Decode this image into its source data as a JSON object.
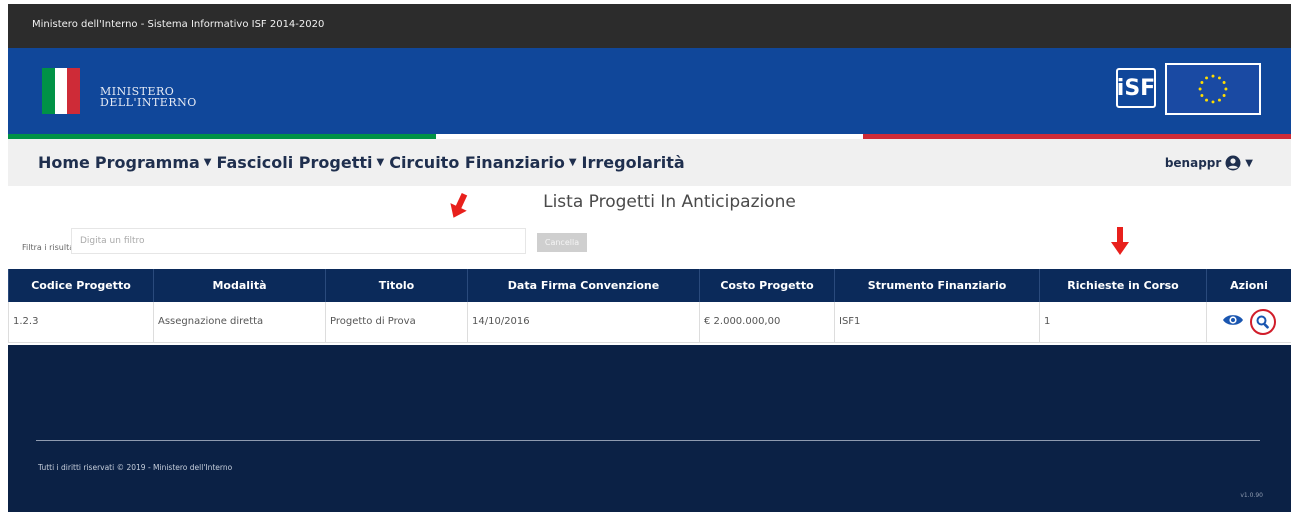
{
  "topbar": {
    "title": "Ministero dell'Interno - Sistema Informativo ISF 2014-2020"
  },
  "header": {
    "logo_line1": "MINISTERO",
    "logo_line2": "DELL'INTERNO",
    "isf_label": "iSF",
    "flag_colors": [
      "#009246",
      "#ffffff",
      "#ce2b37"
    ]
  },
  "nav": {
    "items": [
      {
        "label": "Home",
        "has_caret": false
      },
      {
        "label": "Programma",
        "has_caret": true
      },
      {
        "label": "Fascicoli Progetti",
        "has_caret": true
      },
      {
        "label": "Circuito Finanziario",
        "has_caret": true
      },
      {
        "label": "Irregolarità",
        "has_caret": false
      }
    ],
    "user": "benappr"
  },
  "page": {
    "title": "Lista Progetti In Anticipazione",
    "filter_label": "Filtra i risultati:",
    "filter_placeholder": "Digita un filtro",
    "clear_label": "Cancella"
  },
  "table": {
    "columns": [
      "Codice Progetto",
      "Modalità",
      "Titolo",
      "Data Firma Convenzione",
      "Costo Progetto",
      "Strumento Finanziario",
      "Richieste in Corso",
      "Azioni"
    ],
    "rows": [
      [
        "1.2.3",
        "Assegnazione diretta",
        "Progetto di Prova",
        "14/10/2016",
        "€ 2.000.000,00",
        "ISF1",
        "1"
      ]
    ],
    "action_icons": [
      "eye-icon",
      "search-icon"
    ]
  },
  "footer": {
    "copyright": "Tutti i diritti riservati © 2019 - Ministero dell'Interno",
    "version": "v1.0.90"
  },
  "colors": {
    "header_blue": "#10479a",
    "table_header": "#0b2a5a",
    "footer_bg": "#0b2145",
    "highlight_red": "#d11d2a"
  }
}
